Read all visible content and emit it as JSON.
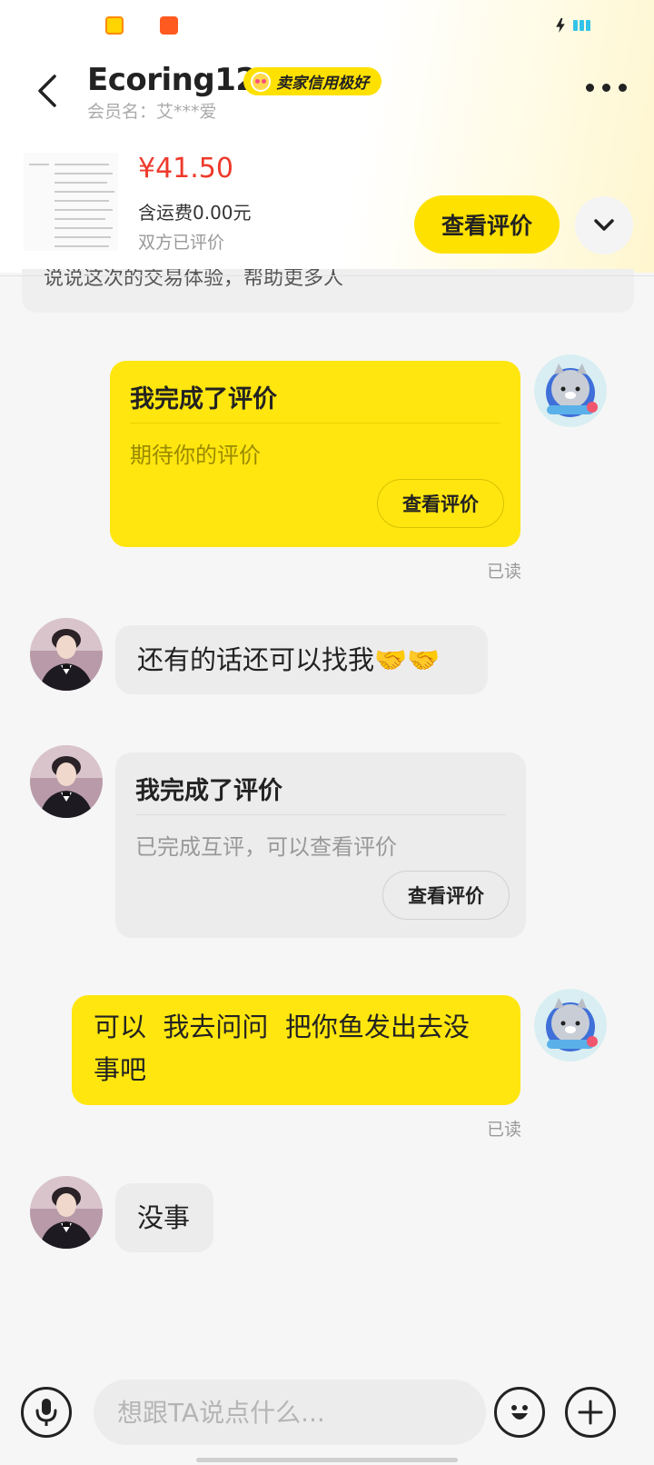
{
  "header": {
    "title": "Ecoring12",
    "badge": "卖家信用极好",
    "member": "会员名：艾***爱"
  },
  "product": {
    "price": "¥41.50",
    "shipping": "含运费0.00元",
    "status": "双方已评价",
    "view_button": "查看评价"
  },
  "partial_card": {
    "text": "说说这次的交易体验，帮助更多人"
  },
  "messages": {
    "m1": {
      "title": "我完成了评价",
      "subtitle": "期待你的评价",
      "button": "查看评价",
      "read": "已读"
    },
    "m2": {
      "text": "还有的话还可以找我🤝🤝"
    },
    "m3": {
      "title": "我完成了评价",
      "subtitle": "已完成互评，可以查看评价",
      "button": "查看评价"
    },
    "m4": {
      "line1": "可以  我去问问  把你鱼发出去没",
      "line2": "事吧",
      "read": "已读"
    },
    "m5": {
      "text": "没事"
    }
  },
  "input": {
    "placeholder": "想跟TA说点什么..."
  },
  "colors": {
    "accent": "#ffe60f",
    "price": "#ee3a2c"
  },
  "icons": [
    "back-icon",
    "more-icon",
    "chevron-down-icon",
    "mic-icon",
    "emoji-icon",
    "plus-icon"
  ]
}
